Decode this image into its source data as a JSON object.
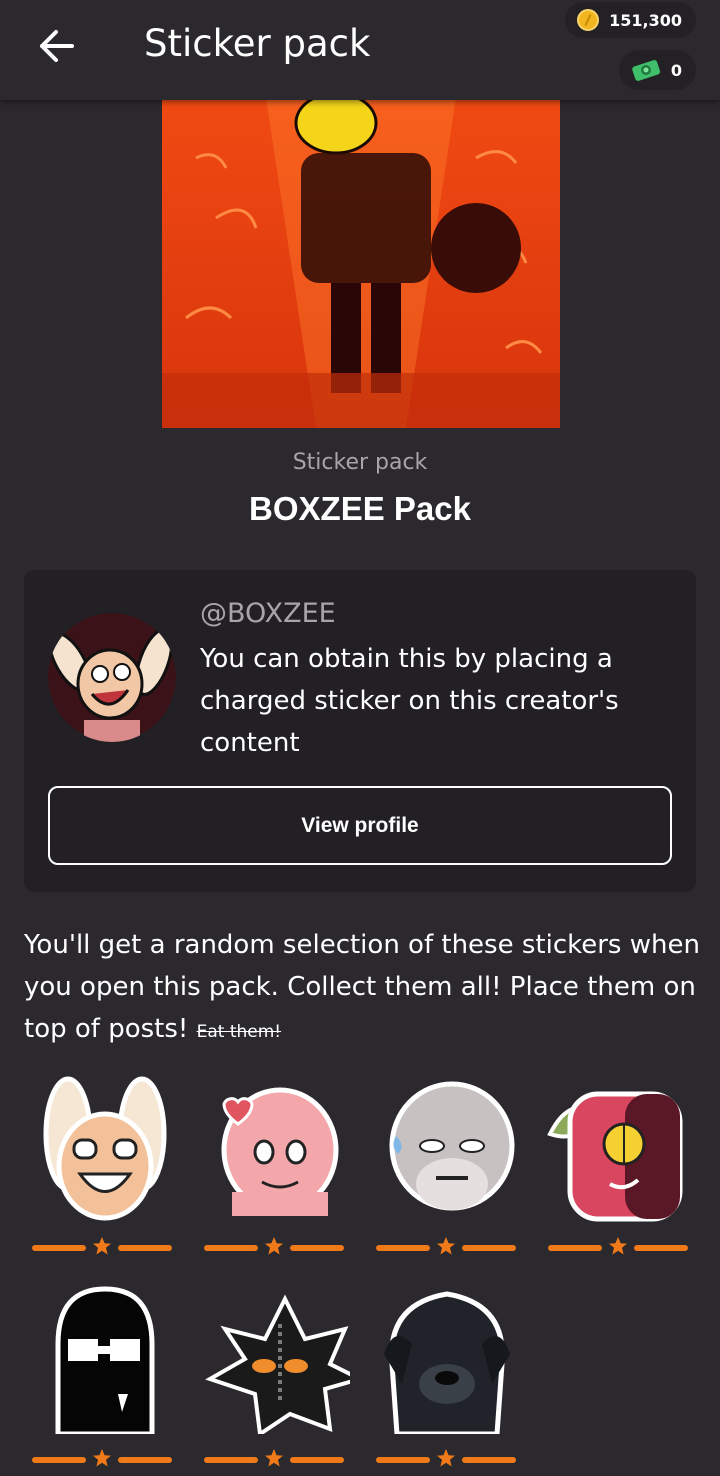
{
  "header": {
    "title": "Sticker pack",
    "coins": "151,300",
    "cash": "0"
  },
  "pack": {
    "label": "Sticker pack",
    "title": "BOXZEE Pack"
  },
  "creator": {
    "handle": "@BOXZEE",
    "description": "You can obtain this by placing a charged sticker on this creator's content",
    "view_profile_label": "View profile"
  },
  "intro": {
    "text": "You'll get a random selection of these stickers when you open this pack. Collect them all! Place them on top of posts! ",
    "struck_text": "Eat them!"
  },
  "stickers": [
    {
      "name": "bunny-ears-laughing",
      "rarity_stars": 1
    },
    {
      "name": "pink-hair-heart",
      "rarity_stars": 1
    },
    {
      "name": "gray-hair-angry",
      "rarity_stars": 1
    },
    {
      "name": "red-cyclops",
      "rarity_stars": 1
    },
    {
      "name": "black-ghost",
      "rarity_stars": 1
    },
    {
      "name": "black-hat-character",
      "rarity_stars": 1
    },
    {
      "name": "black-dog-photo",
      "rarity_stars": 1
    }
  ],
  "colors": {
    "background": "#2b292d",
    "card": "#222024",
    "accent_orange": "#f07a1a",
    "muted_text": "#a7a5aa"
  }
}
